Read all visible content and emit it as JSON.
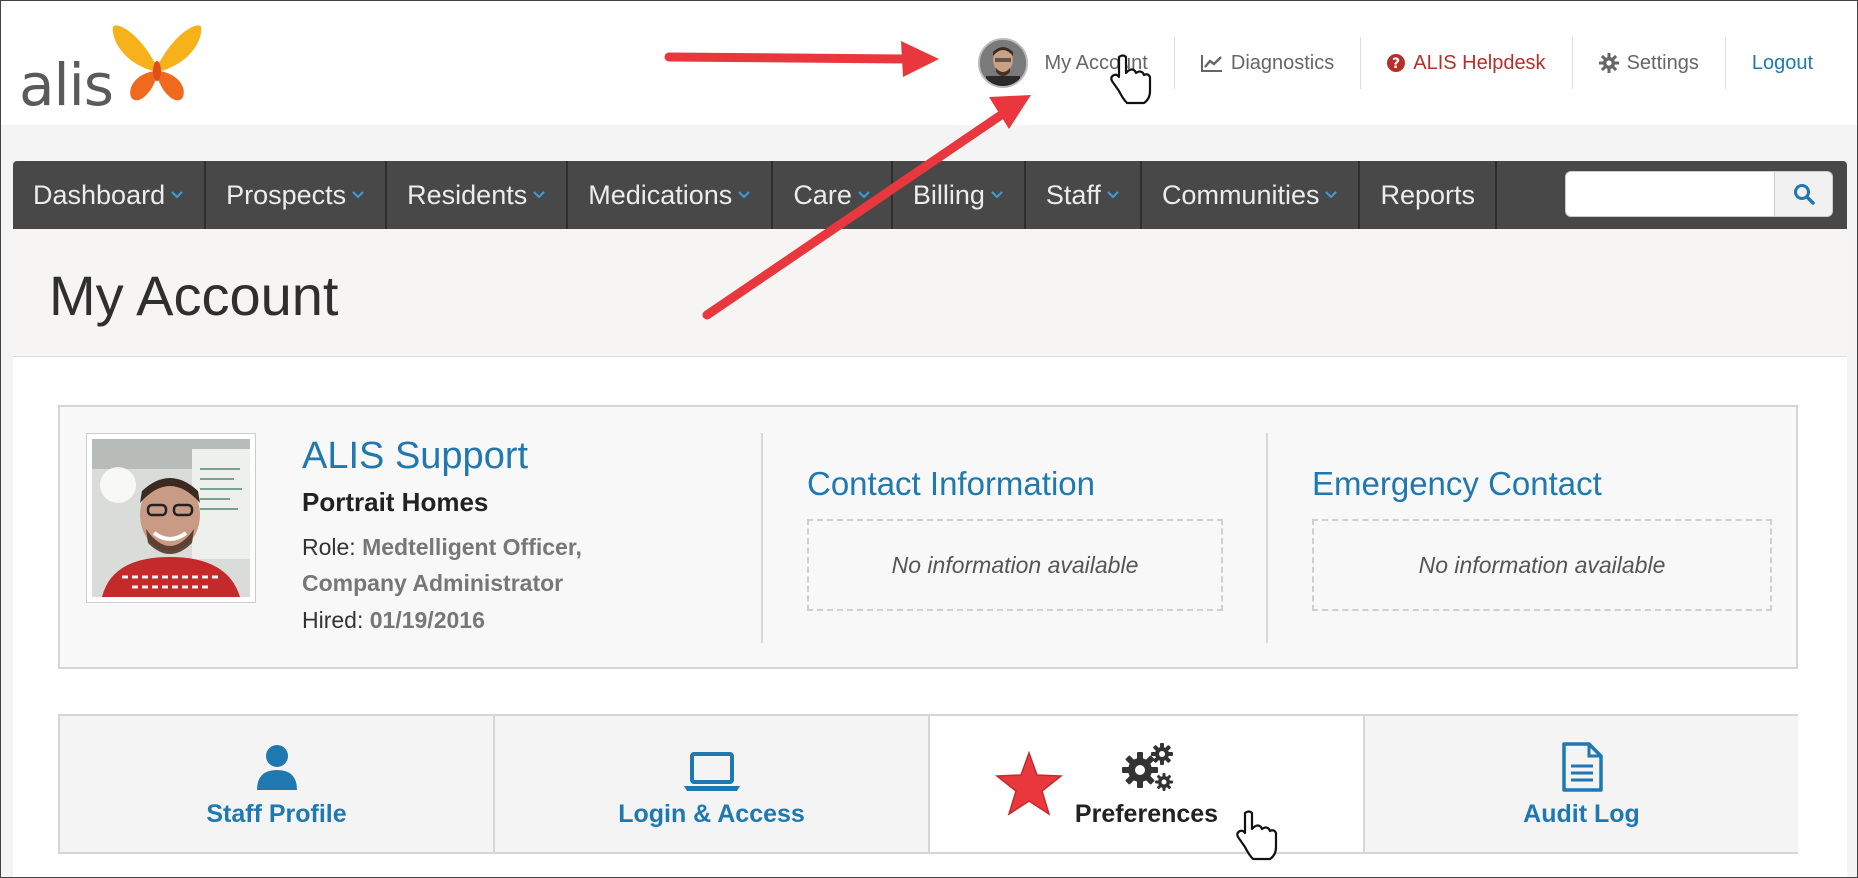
{
  "header": {
    "logo_text": "alis",
    "links": {
      "my_account": "My Account",
      "diagnostics": "Diagnostics",
      "helpdesk": "ALIS Helpdesk",
      "settings": "Settings",
      "logout": "Logout"
    }
  },
  "nav": {
    "items": [
      "Dashboard",
      "Prospects",
      "Residents",
      "Medications",
      "Care",
      "Billing",
      "Staff",
      "Communities",
      "Reports"
    ],
    "search": {
      "placeholder": "",
      "value": ""
    }
  },
  "page": {
    "title": "My Account"
  },
  "profile": {
    "name": "ALIS Support",
    "company": "Portrait Homes",
    "role_label": "Role:",
    "role_value": "Medtelligent Officer, Company Administrator",
    "hired_label": "Hired:",
    "hired_value": "01/19/2016"
  },
  "contact": {
    "title": "Contact Information",
    "empty": "No information available"
  },
  "emergency": {
    "title": "Emergency Contact",
    "empty": "No information available"
  },
  "tabs": [
    {
      "label": "Staff Profile",
      "icon": "user-icon"
    },
    {
      "label": "Login & Access",
      "icon": "laptop-icon"
    },
    {
      "label": "Preferences",
      "icon": "gears-icon",
      "active": true
    },
    {
      "label": "Audit Log",
      "icon": "document-icon"
    }
  ],
  "colors": {
    "accent": "#1f79b0",
    "nav": "#484848",
    "helpdesk": "#b5302a",
    "annotation": "#e8383d"
  }
}
